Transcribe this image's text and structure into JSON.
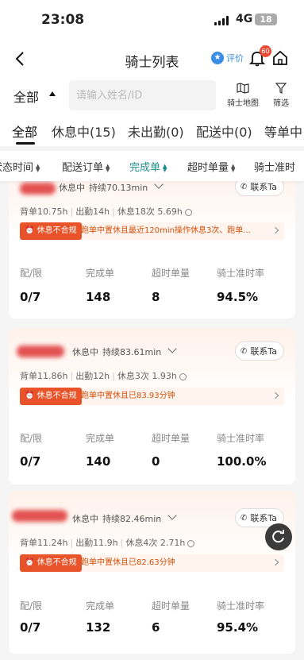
{
  "status_bar": {
    "time": "23:08",
    "network": "4G",
    "battery": "18"
  },
  "header": {
    "title": "骑士列表",
    "rate_label": "评价",
    "bell_badge": "60"
  },
  "filter": {
    "scope": "全部",
    "search_placeholder": "请输入姓名/ID",
    "map_label": "骑士地图",
    "filter_label": "筛选"
  },
  "tabs": [
    {
      "label": "全部"
    },
    {
      "label": "休息中(15)"
    },
    {
      "label": "未出勤(0)"
    },
    {
      "label": "配送中(0)"
    },
    {
      "label": "等单中"
    }
  ],
  "sort": [
    {
      "label": "状态时间"
    },
    {
      "label": "配送订单"
    },
    {
      "label": "完成单"
    },
    {
      "label": "超时单量"
    },
    {
      "label": "骑士准时"
    }
  ],
  "metric_labels": [
    "配/限",
    "完成单",
    "超时单量",
    "骑士准时率"
  ],
  "contact_label": "联系Ta",
  "riders": [
    {
      "status": "休息中",
      "duration": "持续70.13min",
      "stats_a": "背单10.75h",
      "stats_b": "出勤14h",
      "stats_c": "休息18次 5.69h",
      "alert_tag": "休息不合规",
      "alert_msg": "跑单中置休且最近120min操作休息3次、跑单...",
      "values": [
        "0/7",
        "148",
        "8",
        "94.5%"
      ]
    },
    {
      "status": "休息中",
      "duration": "持续83.61min",
      "stats_a": "背单11.86h",
      "stats_b": "出勤12h",
      "stats_c": "休息3次 1.93h",
      "alert_tag": "休息不合规",
      "alert_msg": "跑单中置休且已83.93分钟",
      "values": [
        "0/7",
        "140",
        "0",
        "100.0%"
      ]
    },
    {
      "status": "休息中",
      "duration": "持续82.46min",
      "stats_a": "背单11.24h",
      "stats_b": "出勤11.9h",
      "stats_c": "休息4次 2.71h",
      "alert_tag": "休息不合规",
      "alert_msg": "跑单中置休且已82.63分钟",
      "values": [
        "0/7",
        "132",
        "6",
        "95.4%"
      ]
    }
  ]
}
